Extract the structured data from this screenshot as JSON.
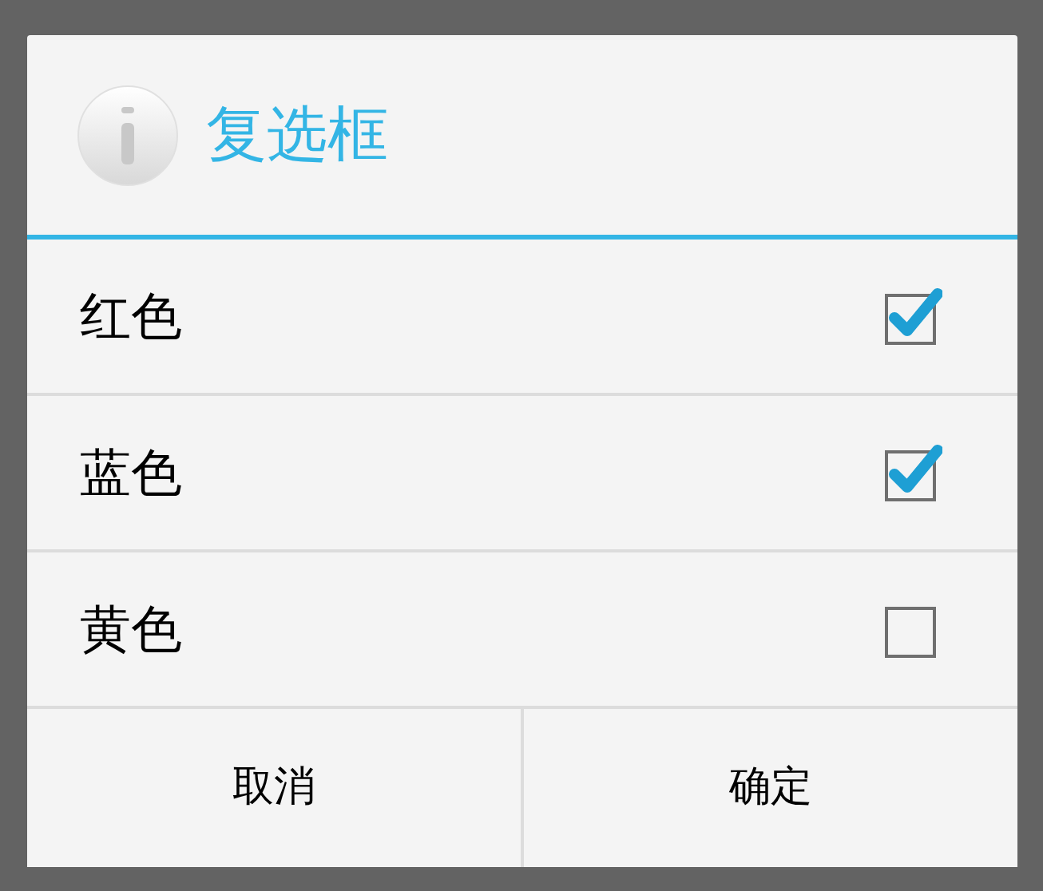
{
  "dialog": {
    "title": "复选框"
  },
  "options": [
    {
      "label": "红色",
      "checked": true
    },
    {
      "label": "蓝色",
      "checked": true
    },
    {
      "label": "黄色",
      "checked": false
    }
  ],
  "buttons": [
    "取消",
    "确定"
  ]
}
